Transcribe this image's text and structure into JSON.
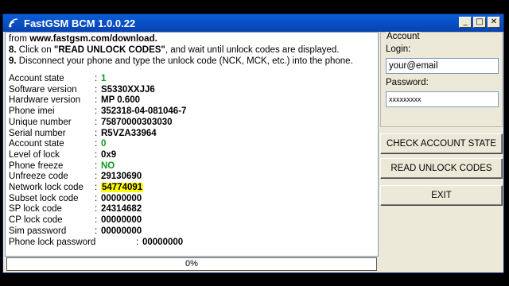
{
  "window": {
    "title": "FastGSM BCM 1.0.0.22",
    "controls": {
      "minimize": "_",
      "maximize": "□",
      "close": "✕"
    }
  },
  "instructions": {
    "line1_prefix": "from ",
    "line1_link": "www.fastgsm.com/download.",
    "line2_num": "8.",
    "line2_text_a": " Click on ",
    "line2_button": "\"READ UNLOCK CODES\"",
    "line2_text_b": ", and wait until unlock codes are displayed.",
    "line3_num": "9.",
    "line3_text": " Disconnect your phone and type the unlock code (NCK, MCK, etc.) into the phone."
  },
  "info_rows": [
    {
      "label": "Account state",
      "value": "1"
    },
    {
      "label": "Software version",
      "value": "S5330XXJJ6"
    },
    {
      "label": "Hardware version",
      "value": "MP 0.600"
    },
    {
      "label": "Phone imei",
      "value": "352318-04-081046-7"
    },
    {
      "label": "Unique number",
      "value": "75870000303030"
    },
    {
      "label": "Serial number",
      "value": "R5VZA33964"
    },
    {
      "label": "Account state",
      "value": "0"
    },
    {
      "label": "Level of lock",
      "value": "0x9"
    },
    {
      "label": "Phone freeze",
      "value": "NO"
    },
    {
      "label": "Unfreeze code",
      "value": "29130690"
    },
    {
      "label": "Network lock code",
      "value": "54774091"
    },
    {
      "label": "Subset lock code",
      "value": "00000000"
    },
    {
      "label": "SP lock code",
      "value": "24314682"
    },
    {
      "label": "CP lock code",
      "value": "00000000"
    },
    {
      "label": "Sim password",
      "value": "00000000"
    },
    {
      "label": "Phone lock password",
      "value": "00000000"
    }
  ],
  "colon": ":",
  "progress": {
    "value": 0,
    "label": "0%"
  },
  "account": {
    "group_title": "Account",
    "login_label": "Login:",
    "login_value": "your@email",
    "password_label": "Password:",
    "password_value": "xxxxxxxxx"
  },
  "buttons": {
    "check_account": "CHECK ACCOUNT STATE",
    "read_unlock": "READ UNLOCK CODES",
    "exit": "EXIT"
  },
  "colors": {
    "green_value": "#0a9a18",
    "highlight": "#ffff00",
    "titlebar": "#0a5fd8"
  }
}
